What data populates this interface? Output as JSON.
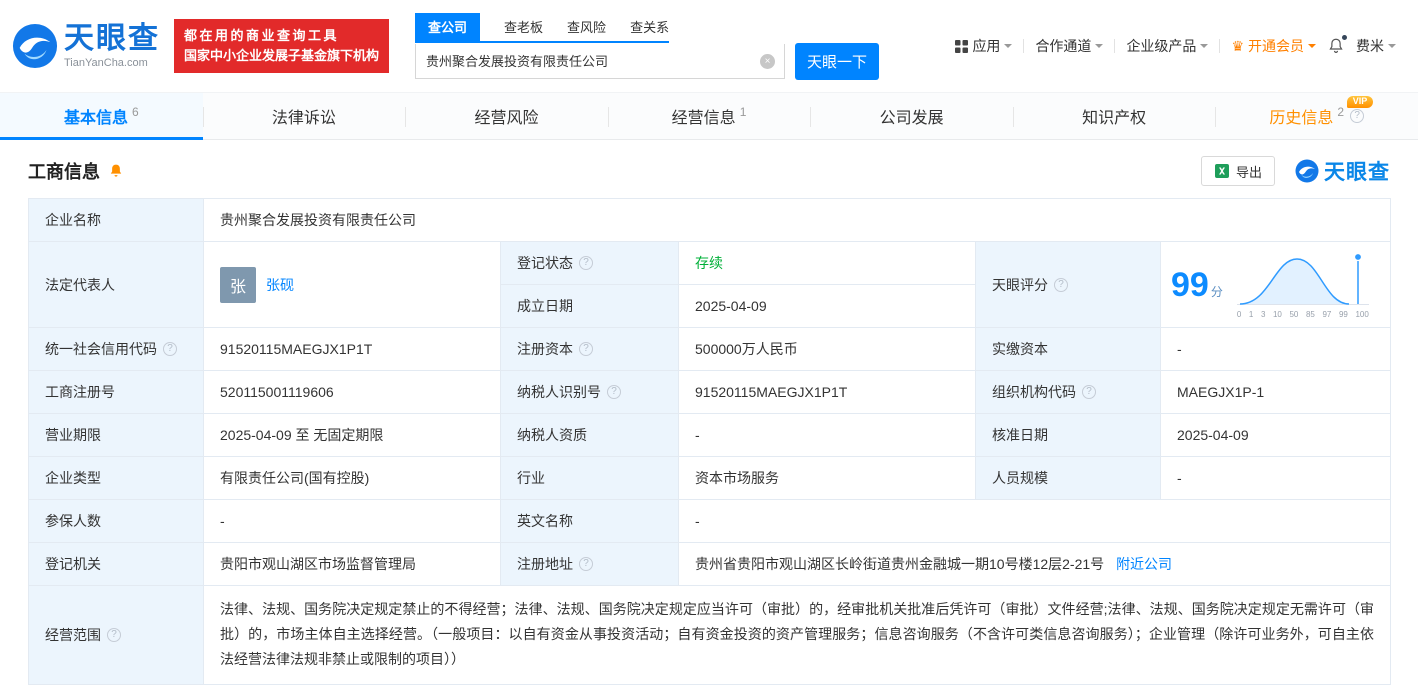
{
  "brand": {
    "name": "天眼查",
    "domain": "TianYanCha.com",
    "slogan_line1": "都在用的商业查询工具",
    "slogan_line2": "国家中小企业发展子基金旗下机构"
  },
  "search": {
    "tabs": [
      {
        "label": "查公司",
        "active": true
      },
      {
        "label": "查老板",
        "active": false
      },
      {
        "label": "查风险",
        "active": false
      },
      {
        "label": "查关系",
        "active": false
      }
    ],
    "value": "贵州聚合发展投资有限责任公司",
    "button": "天眼一下"
  },
  "top_nav": {
    "apps": "应用",
    "partner": "合作通道",
    "enterprise": "企业级产品",
    "vip": "开通会员",
    "user": "费米"
  },
  "page_tabs": [
    {
      "label": "基本信息",
      "count": "6"
    },
    {
      "label": "法律诉讼",
      "count": ""
    },
    {
      "label": "经营风险",
      "count": ""
    },
    {
      "label": "经营信息",
      "count": "1"
    },
    {
      "label": "公司发展",
      "count": ""
    },
    {
      "label": "知识产权",
      "count": ""
    },
    {
      "label": "历史信息",
      "count": "2",
      "badge": "VIP"
    }
  ],
  "section": {
    "title": "工商信息",
    "export": "导出",
    "watermark": "天眼查"
  },
  "fields": {
    "company_name": {
      "label": "企业名称",
      "value": "贵州聚合发展投资有限责任公司"
    },
    "legal_rep": {
      "label": "法定代表人",
      "avatar": "张",
      "value": "张砚"
    },
    "reg_status": {
      "label": "登记状态",
      "value": "存续"
    },
    "establish_date": {
      "label": "成立日期",
      "value": "2025-04-09"
    },
    "score": {
      "label": "天眼评分",
      "value": "99",
      "unit": "分",
      "axis": [
        "0",
        "1",
        "3",
        "10",
        "50",
        "85",
        "97",
        "99",
        "100"
      ]
    },
    "credit_code": {
      "label": "统一社会信用代码",
      "value": "91520115MAEGJX1P1T"
    },
    "reg_capital": {
      "label": "注册资本",
      "value": "500000万人民币"
    },
    "paid_capital": {
      "label": "实缴资本",
      "value": "-"
    },
    "reg_no": {
      "label": "工商注册号",
      "value": "520115001119606"
    },
    "taxpayer_no": {
      "label": "纳税人识别号",
      "value": "91520115MAEGJX1P1T"
    },
    "org_code": {
      "label": "组织机构代码",
      "value": "MAEGJX1P-1"
    },
    "term": {
      "label": "营业期限",
      "value": "2025-04-09 至 无固定期限"
    },
    "taxpayer_quality": {
      "label": "纳税人资质",
      "value": "-"
    },
    "approve_date": {
      "label": "核准日期",
      "value": "2025-04-09"
    },
    "company_type": {
      "label": "企业类型",
      "value": "有限责任公司(国有控股)"
    },
    "industry": {
      "label": "行业",
      "value": "资本市场服务"
    },
    "staff": {
      "label": "人员规模",
      "value": "-"
    },
    "insured": {
      "label": "参保人数",
      "value": "-"
    },
    "english_name": {
      "label": "英文名称",
      "value": "-"
    },
    "reg_org": {
      "label": "登记机关",
      "value": "贵阳市观山湖区市场监督管理局"
    },
    "address": {
      "label": "注册地址",
      "value": "贵州省贵阳市观山湖区长岭街道贵州金融城一期10号楼12层2-21号",
      "link": "附近公司"
    },
    "scope": {
      "label": "经营范围",
      "value": "法律、法规、国务院决定规定禁止的不得经营；法律、法规、国务院决定规定应当许可（审批）的，经审批机关批准后凭许可（审批）文件经营;法律、法规、国务院决定规定无需许可（审批）的，市场主体自主选择经营。（一般项目：以自有资金从事投资活动；自有资金投资的资产管理服务；信息咨询服务（不含许可类信息咨询服务）；企业管理（除许可业务外，可自主依法经营法律法规非禁止或限制的项目））"
    }
  },
  "colors": {
    "primary": "#0084ff",
    "orange": "#ff9000",
    "green": "#00b038",
    "red": "#e22a2a",
    "label_bg": "#ecf5fd"
  }
}
